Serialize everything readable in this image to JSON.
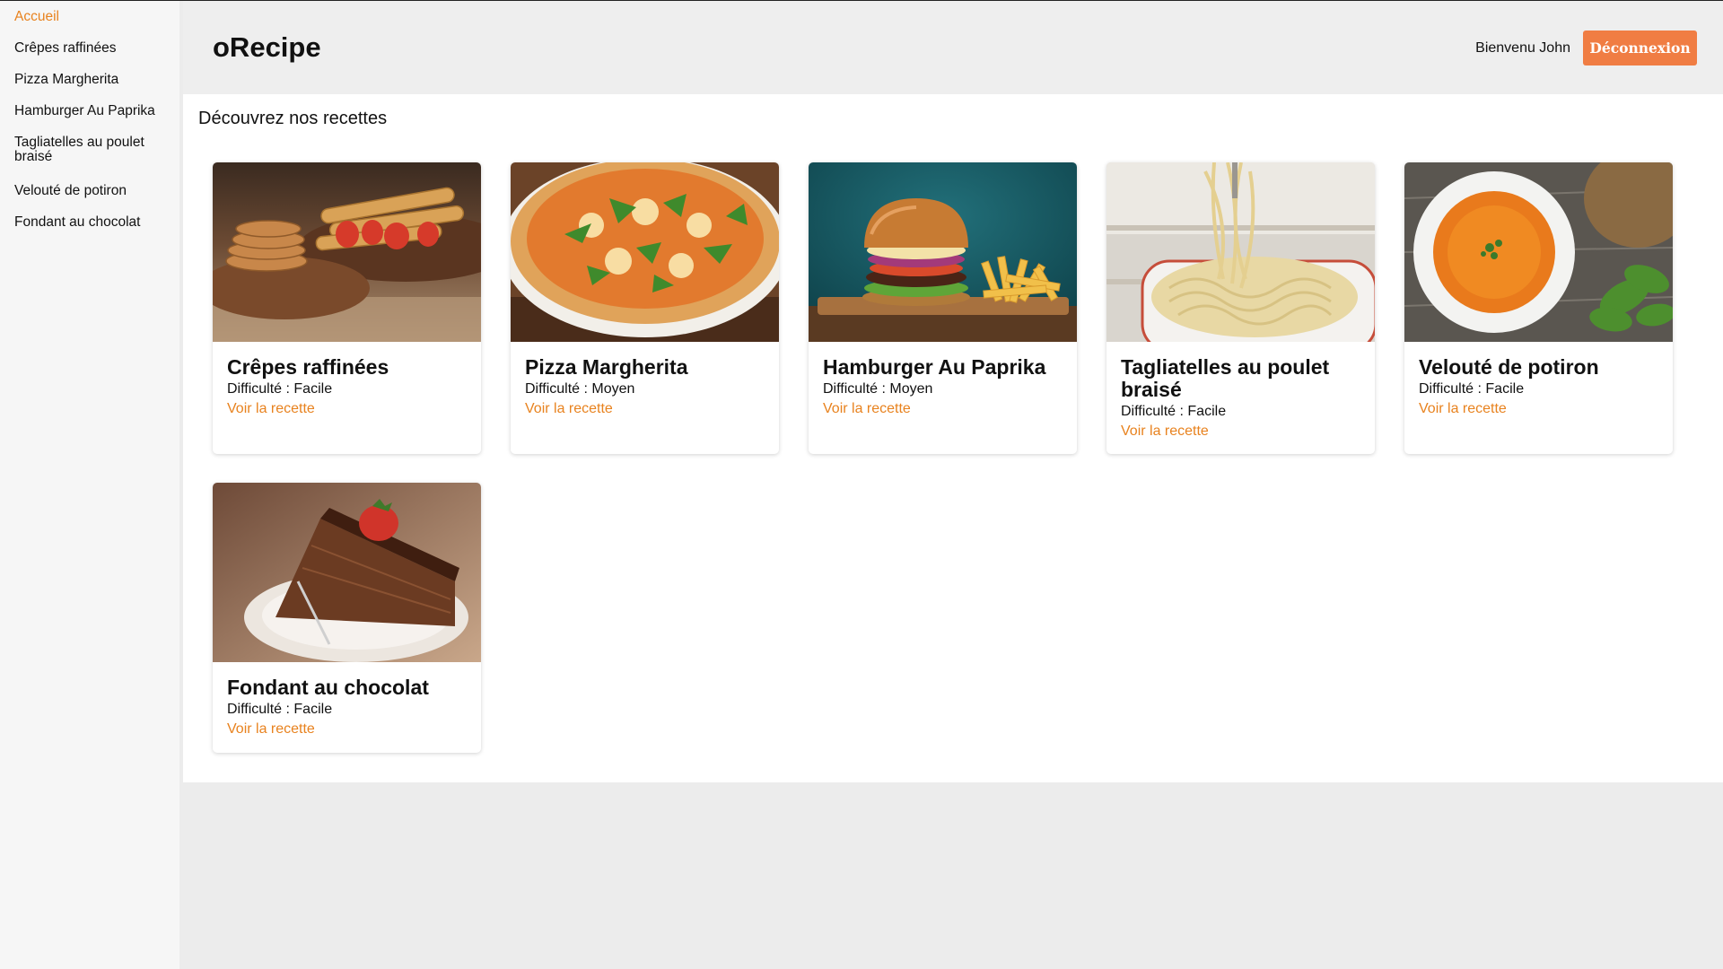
{
  "sidebar": {
    "items": [
      {
        "label": "Accueil",
        "active": true
      },
      {
        "label": "Crêpes raffinées"
      },
      {
        "label": "Pizza Margherita"
      },
      {
        "label": "Hamburger Au Paprika"
      },
      {
        "label": "Tagliatelles au poulet braisé"
      },
      {
        "label": "Velouté de potiron"
      },
      {
        "label": "Fondant au chocolat"
      }
    ]
  },
  "header": {
    "brand": "oRecipe",
    "welcome": "Bienvenu John",
    "logout_label": "Déconnexion"
  },
  "main": {
    "title": "Découvrez nos recettes",
    "recipes": [
      {
        "title": "Crêpes raffinées",
        "difficulty_label": "Difficulté :",
        "difficulty": "Facile",
        "link": "Voir la recette",
        "image": "crepes-photo"
      },
      {
        "title": "Pizza Margherita",
        "difficulty_label": "Difficulté :",
        "difficulty": "Moyen",
        "link": "Voir la recette",
        "image": "pizza-photo"
      },
      {
        "title": "Hamburger Au Paprika",
        "difficulty_label": "Difficulté :",
        "difficulty": "Moyen",
        "link": "Voir la recette",
        "image": "burger-photo"
      },
      {
        "title": "Tagliatelles au poulet braisé",
        "difficulty_label": "Difficulté :",
        "difficulty": "Facile",
        "link": "Voir la recette",
        "image": "pasta-photo"
      },
      {
        "title": "Velouté de potiron",
        "difficulty_label": "Difficulté :",
        "difficulty": "Facile",
        "link": "Voir la recette",
        "image": "soup-photo"
      },
      {
        "title": "Fondant au chocolat",
        "difficulty_label": "Difficulté :",
        "difficulty": "Facile",
        "link": "Voir la recette",
        "image": "cake-photo"
      }
    ]
  },
  "colors": {
    "accent": "#e8821e",
    "button": "#f07d43",
    "sidebar_bg": "#f6f6f6",
    "header_bg": "#eeeeee"
  }
}
